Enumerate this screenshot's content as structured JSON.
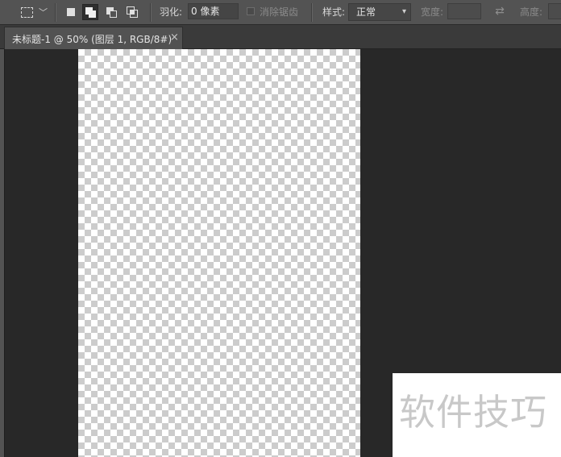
{
  "options_bar": {
    "tool_preset_icon": "rect-marquee-icon",
    "selection_modes": [
      {
        "icon": "new-selection-icon",
        "active": false
      },
      {
        "icon": "add-to-selection-icon",
        "active": true
      },
      {
        "icon": "subtract-from-selection-icon",
        "active": false
      },
      {
        "icon": "intersect-selection-icon",
        "active": false
      }
    ],
    "feather_label": "羽化:",
    "feather_value": "0 像素",
    "anti_alias_label": "消除锯齿",
    "style_label": "样式:",
    "style_value": "正常",
    "width_label": "宽度:",
    "swap_icon": "⇄",
    "height_label": "高度:"
  },
  "document": {
    "tab_title": "未标题-1 @ 50% (图层 1, RGB/8#)",
    "close_glyph": "×"
  },
  "watermark": {
    "text": "软件技巧"
  }
}
